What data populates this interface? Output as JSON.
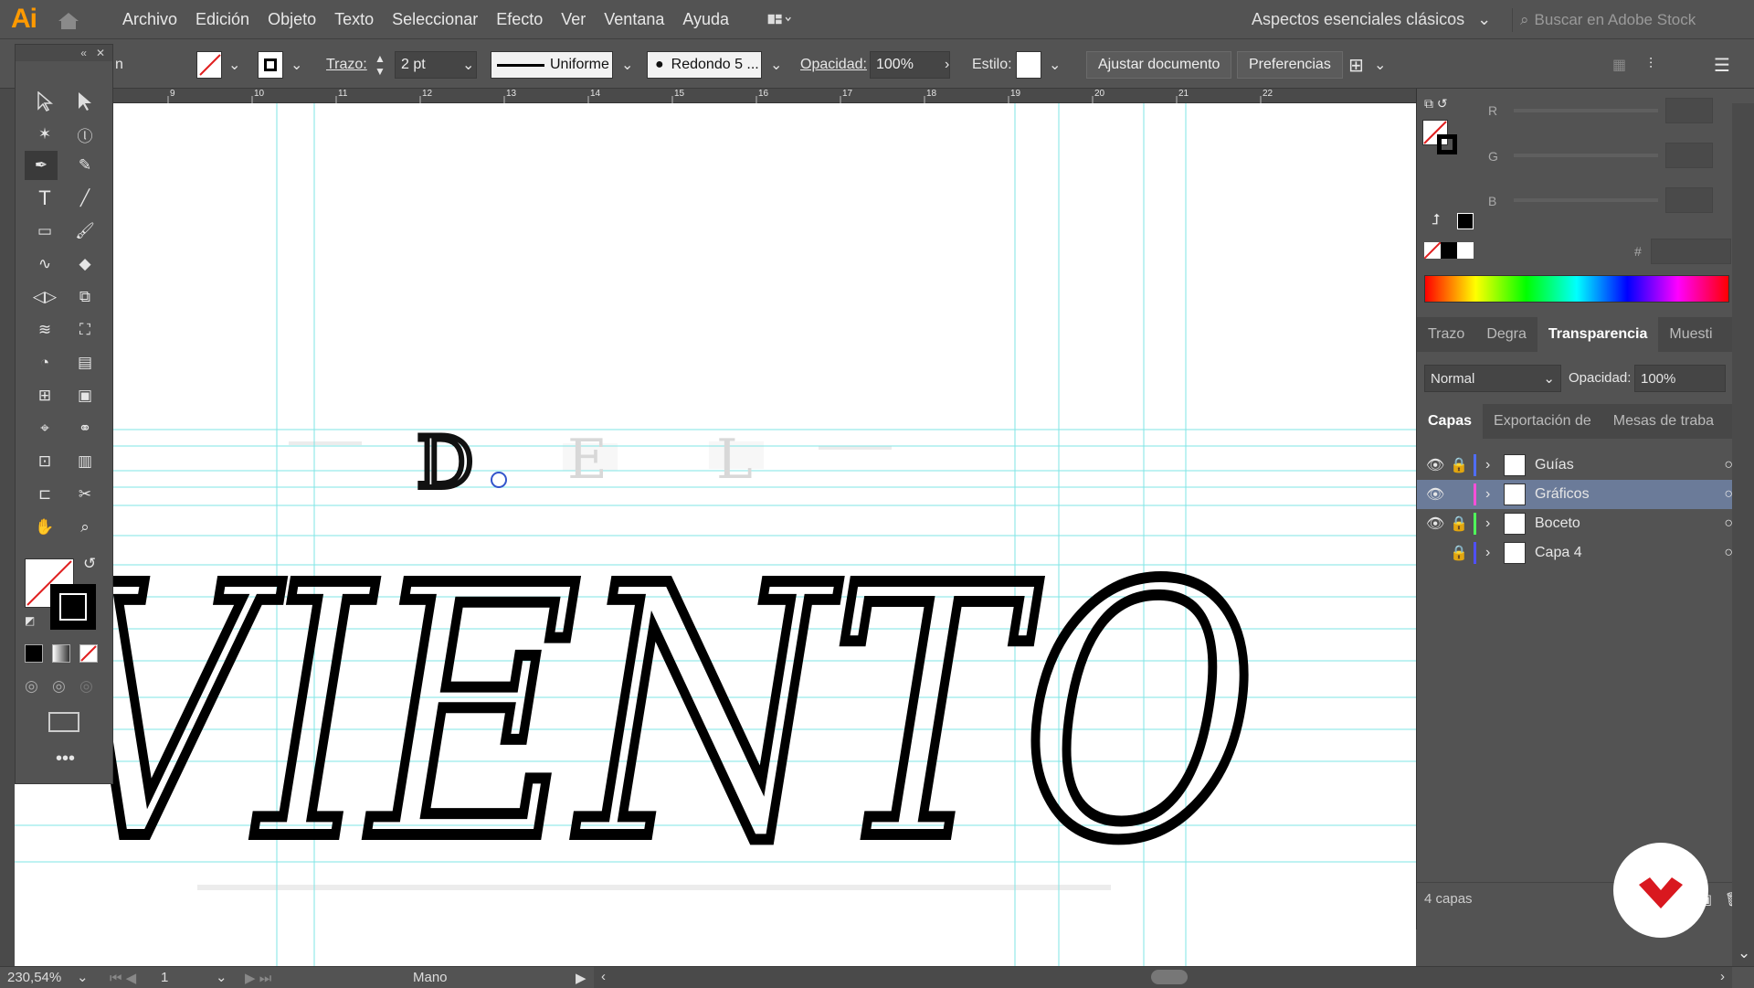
{
  "menubar": {
    "logo": "Ai",
    "items": [
      "Archivo",
      "Edición",
      "Objeto",
      "Texto",
      "Seleccionar",
      "Efecto",
      "Ver",
      "Ventana",
      "Ayuda"
    ],
    "workspace": "Aspectos esenciales clásicos",
    "stock_placeholder": "Buscar en Adobe Stock"
  },
  "control": {
    "tool_label_partial": "n",
    "trazo_label": "Trazo:",
    "trazo_value": "2 pt",
    "profile": "Uniforme",
    "brush": "Redondo 5 ...",
    "opacity_label": "Opacidad:",
    "opacity_value": "100%",
    "style_label": "Estilo:",
    "fit_doc": "Ajustar documento",
    "prefs": "Preferencias"
  },
  "rulers": {
    "top_ticks": [
      "9",
      "10",
      "11",
      "12",
      "13",
      "14",
      "15",
      "16",
      "17",
      "18",
      "19",
      "20",
      "21",
      "22"
    ]
  },
  "color_panel": {
    "r_label": "R",
    "g_label": "G",
    "b_label": "B",
    "hex_label": "#"
  },
  "transparency": {
    "tabs": [
      "Trazo",
      "Degra",
      "Transparencia",
      "Muesti"
    ],
    "mode": "Normal",
    "opacity_label": "Opacidad:",
    "opacity_value": "100%"
  },
  "layers": {
    "tabs": [
      "Capas",
      "Exportación de",
      "Mesas de traba"
    ],
    "rows": [
      {
        "name": "Guías",
        "color": "#4f6dff"
      },
      {
        "name": "Gráficos",
        "color": "#ff4fd8"
      },
      {
        "name": "Boceto",
        "color": "#4fff5a"
      },
      {
        "name": "Capa 4",
        "color": "#4f4fff"
      }
    ],
    "count": "4 capas"
  },
  "status": {
    "zoom": "230,54%",
    "artboard": "1",
    "tool": "Mano"
  },
  "artwork": {
    "small_letters": [
      "D",
      "E",
      "L"
    ],
    "big_letters": "VIENTO"
  }
}
